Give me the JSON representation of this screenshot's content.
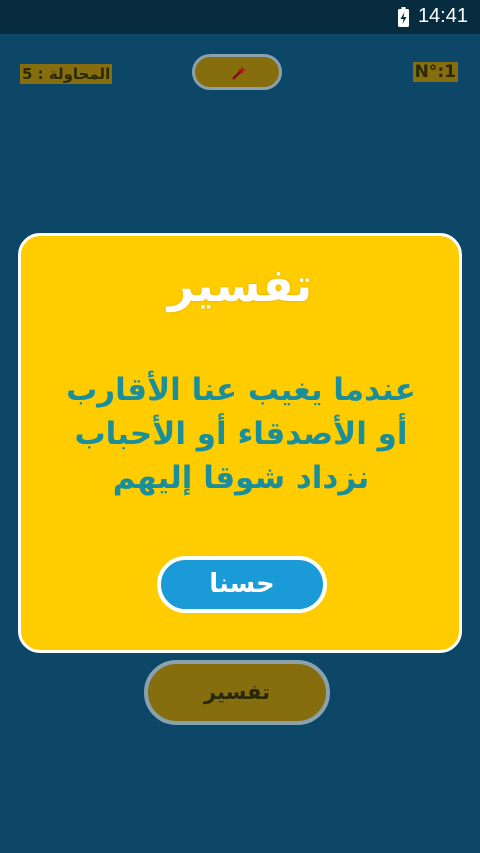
{
  "status_bar": {
    "time": "14:41",
    "battery_icon": "battery-charging-icon"
  },
  "header": {
    "attempts_label": "المحاولة : 5",
    "number_label": "N°:1",
    "hint_icon": "wand-icon"
  },
  "footer": {
    "explanation_button_label": "تفسير"
  },
  "dialog": {
    "title": "تفسير",
    "body": "عندما يغيب عنا الأقارب أو الأصدقاء أو الأحباب نزداد شوقا إليهم",
    "ok_button_label": "حسنا"
  },
  "colors": {
    "background": "#0c4768",
    "dialog": "#ffcc00",
    "ok_button": "#1a9ad6",
    "body_text": "#1a8e9b"
  }
}
